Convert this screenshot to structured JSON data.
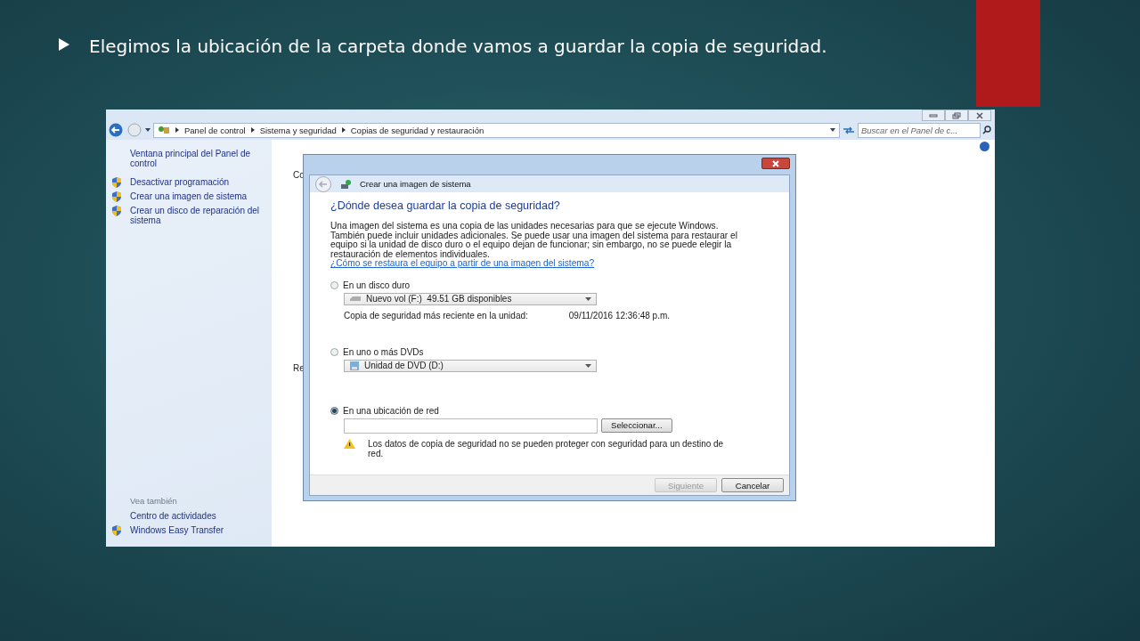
{
  "slide": {
    "text": "Elegimos la ubicación de la carpeta donde vamos a guardar la copia de seguridad."
  },
  "window": {
    "breadcrumb": [
      "Panel de control",
      "Sistema y seguridad",
      "Copias de seguridad y restauración"
    ],
    "search": {
      "placeholder": "Buscar en el Panel de c..."
    },
    "sidebar": {
      "home_link": "Ventana principal del Panel de control",
      "tasks": [
        {
          "label": "Desactivar programación",
          "shield": true
        },
        {
          "label": "Crear una imagen de sistema",
          "shield": true
        },
        {
          "label": "Crear un disco de reparación del sistema",
          "shield": true
        }
      ],
      "see_also_title": "Vea también",
      "see_also": [
        {
          "label": "Centro de actividades",
          "shield": false
        },
        {
          "label": "Windows Easy Transfer",
          "shield": true
        }
      ]
    },
    "main_fragments": [
      "Co",
      "Re"
    ]
  },
  "dialog": {
    "title": "Crear una imagen de sistema",
    "heading": "¿Dónde desea guardar la copia de seguridad?",
    "description": "Una imagen del sistema es una copia de las unidades necesarias para que se ejecute Windows. También puede incluir unidades adicionales. Se puede usar una imagen del sistema para restaurar el equipo si la unidad de disco duro o el equipo dejan de funcionar; sin embargo, no se puede elegir la restauración de elementos individuales.",
    "link": "¿Cómo se restaura el equipo a partir de una imagen del sistema?",
    "options": [
      {
        "kind": "drive",
        "label": "En un disco duro",
        "selected": false,
        "dropdown": "Nuevo vol (F:)  49.51 GB disponibles",
        "info_label": "Copia de seguridad más reciente en la unidad:",
        "info_value": "09/11/2016 12:36:48 p.m."
      },
      {
        "kind": "dvd",
        "label": "En uno o más DVDs",
        "selected": false,
        "dropdown": "Unidad de DVD (D:)"
      },
      {
        "kind": "network",
        "label": "En una ubicación de red",
        "selected": true,
        "button": "Seleccionar...",
        "warning": "Los datos de copia de seguridad no se pueden proteger con seguridad para un destino de red."
      }
    ],
    "buttons": [
      {
        "label": "Siguiente",
        "disabled": true
      },
      {
        "label": "Cancelar",
        "disabled": false
      }
    ]
  }
}
